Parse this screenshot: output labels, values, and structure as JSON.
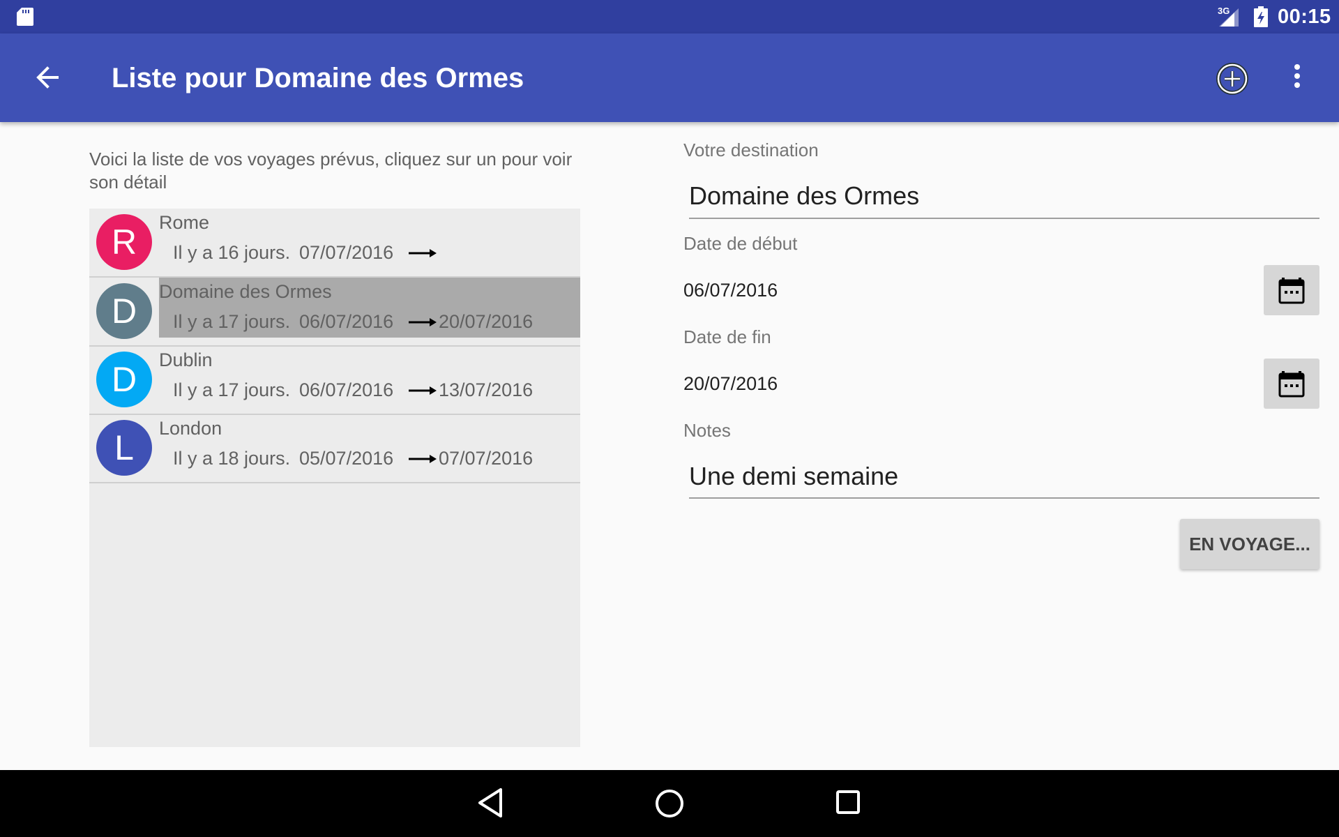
{
  "status_bar": {
    "time": "00:15",
    "network": "3G",
    "icons": [
      "sd-card-icon",
      "signal-3g-icon",
      "battery-charging-icon"
    ]
  },
  "app_bar": {
    "title": "Liste pour Domaine des Ormes",
    "icons": [
      "arrow-back-icon",
      "add-circle-icon",
      "more-vert-icon"
    ],
    "color": "#3f51b5"
  },
  "intro_text": "Voici la liste de vos voyages prévus, cliquez sur un pour voir son détail",
  "trips": [
    {
      "initial": "R",
      "name": "Rome",
      "ago": "Il y a 16 jours.",
      "start": "07/07/2016",
      "end": "",
      "color": "#e91e63",
      "selected": false
    },
    {
      "initial": "D",
      "name": "Domaine des Ormes",
      "ago": "Il y a 17 jours.",
      "start": "06/07/2016",
      "end": "20/07/2016",
      "color": "#607d8b",
      "selected": true
    },
    {
      "initial": "D",
      "name": "Dublin",
      "ago": "Il y a 17 jours.",
      "start": "06/07/2016",
      "end": "13/07/2016",
      "color": "#03a9f4",
      "selected": false
    },
    {
      "initial": "L",
      "name": "London",
      "ago": "Il y a 18 jours.",
      "start": "05/07/2016",
      "end": "07/07/2016",
      "color": "#3f51b5",
      "selected": false
    }
  ],
  "form": {
    "destination_label": "Votre destination",
    "destination_value": "Domaine des Ormes",
    "start_label": "Date de début",
    "start_value": "06/07/2016",
    "end_label": "Date de fin",
    "end_value": "20/07/2016",
    "notes_label": "Notes",
    "notes_value": "Une demi semaine",
    "voyage_button": "EN VOYAGE..."
  },
  "nav_bar": {
    "icons": [
      "nav-back-icon",
      "nav-home-icon",
      "nav-recents-icon"
    ]
  }
}
